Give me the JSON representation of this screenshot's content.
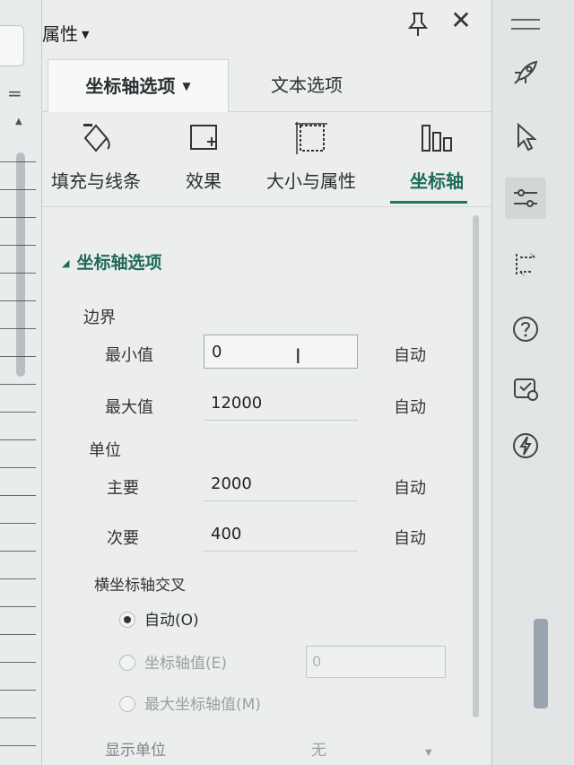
{
  "panel": {
    "title": "属性",
    "tabs": [
      {
        "label": "坐标轴选项",
        "active": true
      },
      {
        "label": "文本选项",
        "active": false
      }
    ],
    "subtabs": [
      {
        "label": "填充与线条",
        "icon": "fill-bucket-icon"
      },
      {
        "label": "效果",
        "icon": "effect-icon"
      },
      {
        "label": "大小与属性",
        "icon": "size-icon"
      },
      {
        "label": "坐标轴",
        "icon": "bar-chart-icon",
        "active": true
      }
    ],
    "section_title": "坐标轴选项",
    "bounds": {
      "label": "边界",
      "min_label": "最小值",
      "min_value": "0",
      "max_label": "最大值",
      "max_value": "12000",
      "auto_label": "自动"
    },
    "units": {
      "label": "单位",
      "major_label": "主要",
      "major_value": "2000",
      "minor_label": "次要",
      "minor_value": "400",
      "auto_label": "自动"
    },
    "cross": {
      "label": "横坐标轴交叉",
      "options": [
        {
          "label": "自动(O)",
          "checked": true
        },
        {
          "label": "坐标轴值(E)",
          "checked": false
        },
        {
          "label": "最大坐标轴值(M)",
          "checked": false
        }
      ],
      "axis_value": "0"
    },
    "display_unit": {
      "label": "显示单位",
      "value": "无"
    }
  },
  "colors": {
    "accent": "#1e7a63",
    "panel_bg": "#eceeee"
  },
  "right_toolbar": [
    "menu-icon",
    "rocket-icon",
    "cursor-icon",
    "settings-sliders-icon",
    "transform-icon",
    "help-icon",
    "cloud-sync-icon",
    "lightning-icon"
  ]
}
